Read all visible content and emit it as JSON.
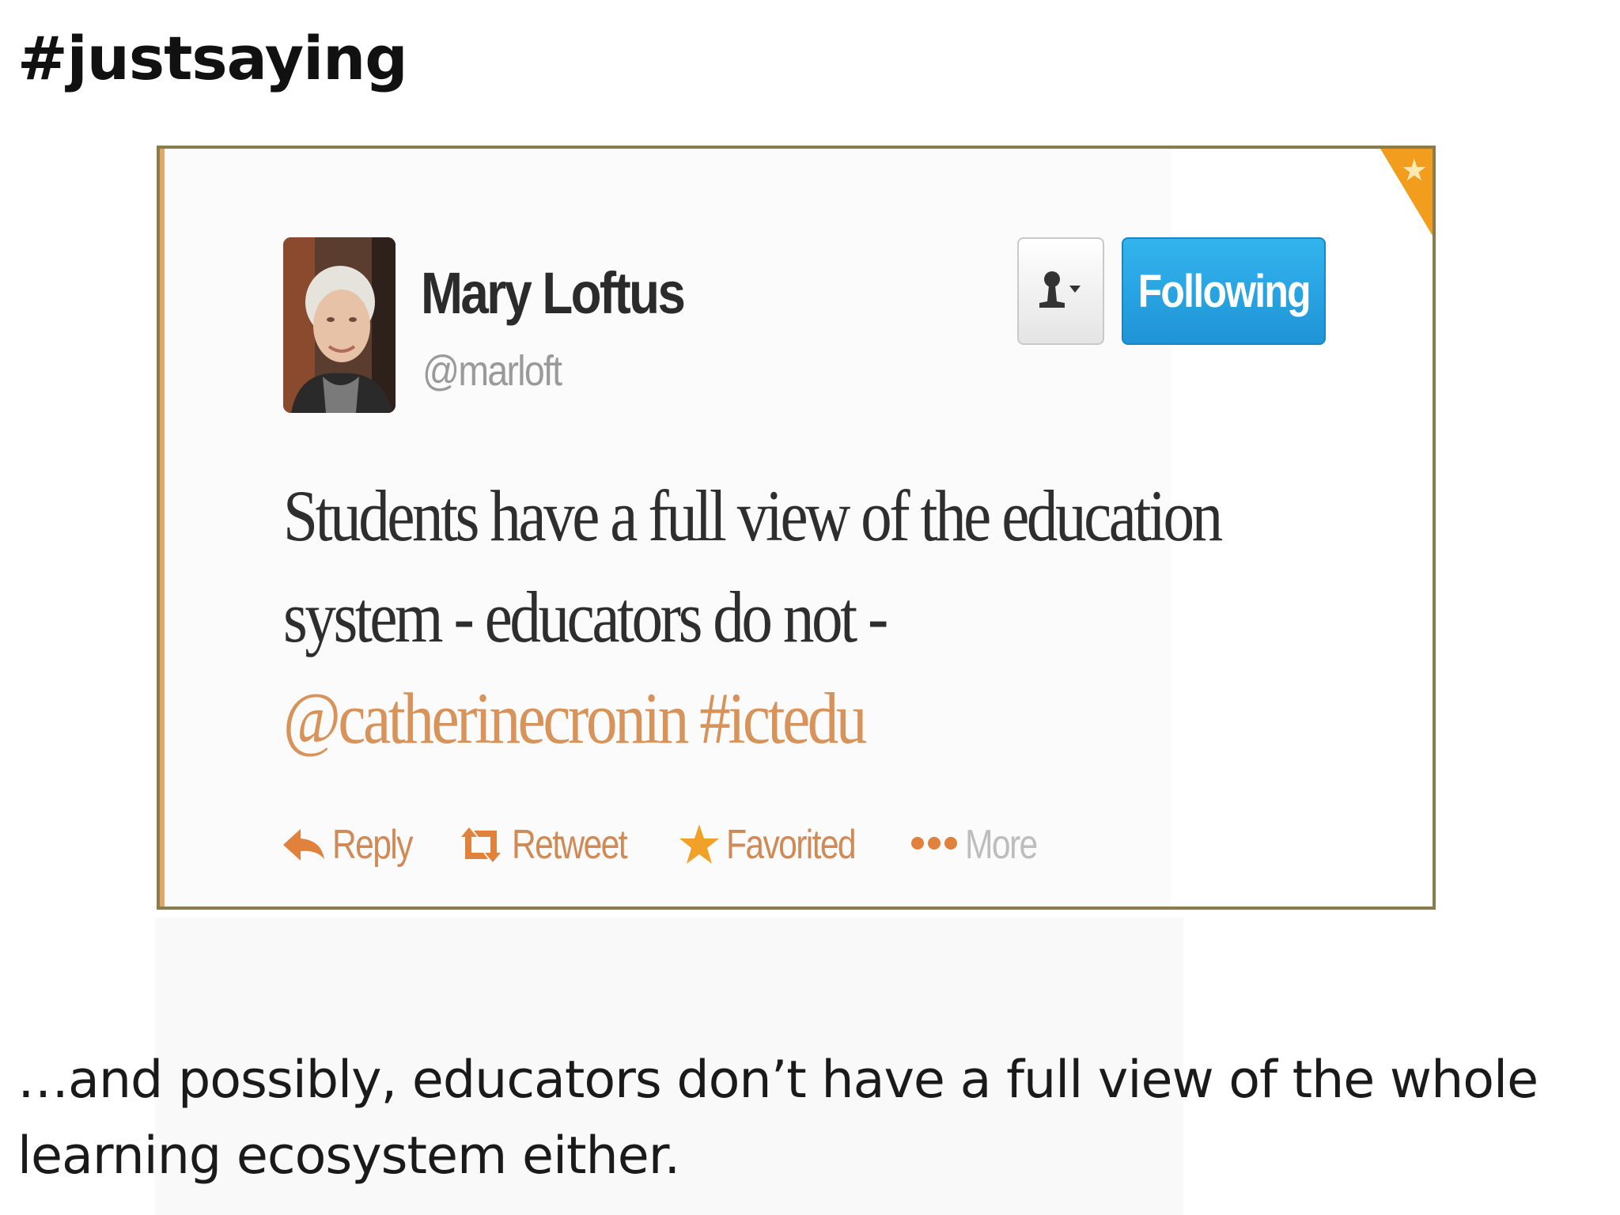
{
  "slide": {
    "title": "#justsaying",
    "caption": "…and possibly, educators don’t have a full view of the whole learning ecosystem either."
  },
  "tweet": {
    "user": {
      "name": "Mary Loftus",
      "handle": "@marloft"
    },
    "follow_button_label": "Following",
    "text_lines": [
      "Students have a full view of the education",
      "system - educators do not -"
    ],
    "mention": "@catherinecronin",
    "hashtag": "#ictedu",
    "actions": {
      "reply": "Reply",
      "retweet": "Retweet",
      "favorited": "Favorited",
      "more": "More"
    },
    "colors": {
      "accent_orange": "#d08a56",
      "follow_blue": "#1f94d6",
      "favorite_corner": "#f29d1e",
      "frame_border": "#8a7d4c"
    },
    "icons": [
      "user-dropdown-icon",
      "reply-icon",
      "retweet-icon",
      "star-icon",
      "more-dots-icon",
      "favorite-corner-star-icon"
    ]
  }
}
